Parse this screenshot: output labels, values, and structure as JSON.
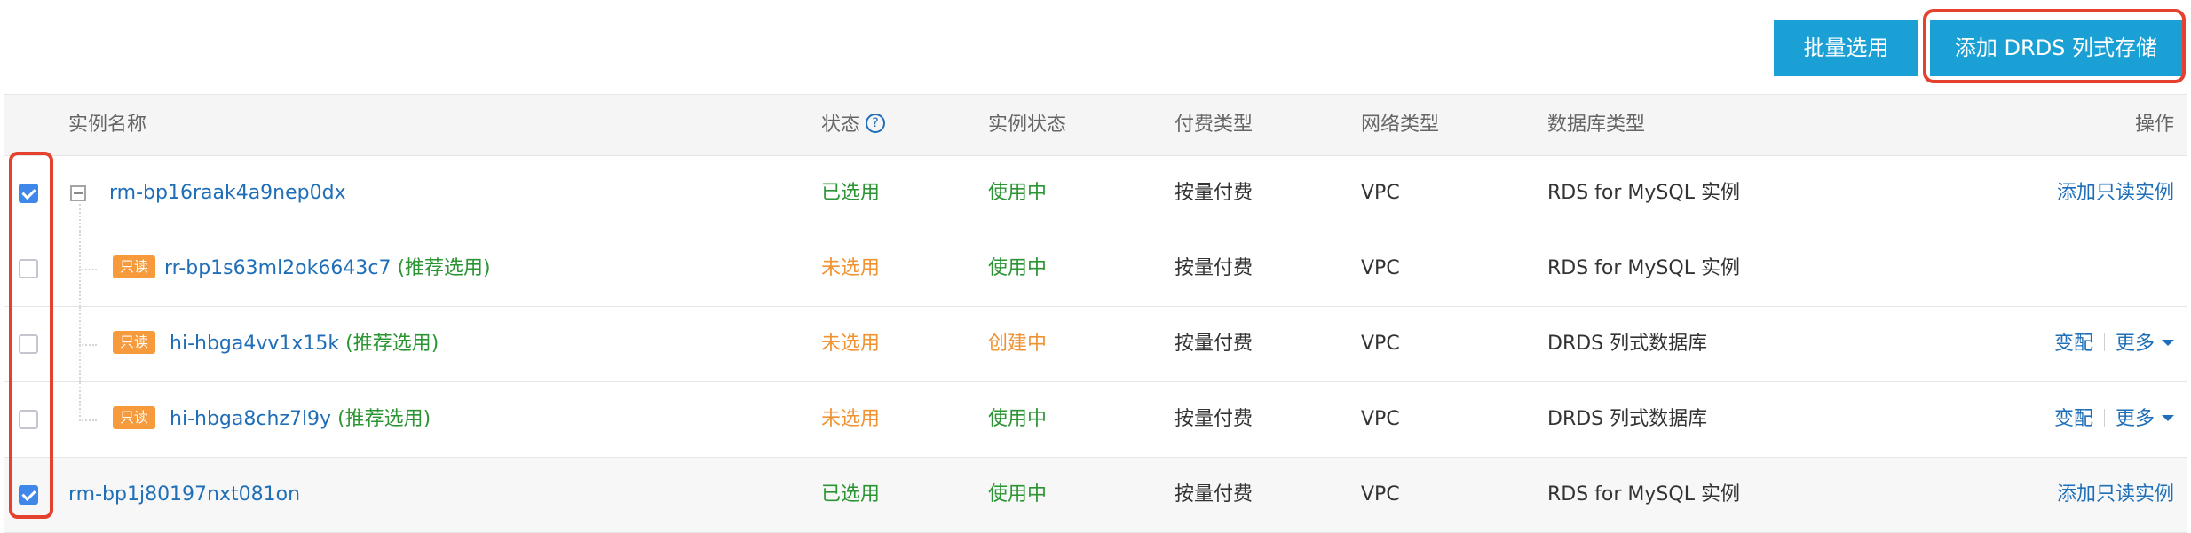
{
  "toolbar": {
    "batch_select_label": "批量选用",
    "add_drds_label": "添加 DRDS 列式存储"
  },
  "colors": {
    "primary_button": "#1aa0d4",
    "highlight_red": "#e4412f",
    "link_blue": "#1f6fb8",
    "status_green": "#2b9433",
    "status_orange": "#f09332",
    "readonly_tag": "#f69a3b",
    "checkbox_checked": "#3f87e8"
  },
  "table": {
    "headers": {
      "name": "实例名称",
      "state": "状态",
      "state_help_icon": "question-circle-icon",
      "state_help_glyph": "?",
      "instance_status": "实例状态",
      "pay_type": "付费类型",
      "network_type": "网络类型",
      "db_type": "数据库类型",
      "operations": "操作"
    },
    "rows": [
      {
        "checked": true,
        "expand_icon": "collapse-minus-icon",
        "name": "rm-bp16raak4a9nep0dx",
        "state": "已选用",
        "instance_status": "使用中",
        "pay_type": "按量付费",
        "network_type": "VPC",
        "db_type": "RDS for MySQL 实例",
        "op_primary": "添加只读实例"
      },
      {
        "checked": false,
        "tag": "只读",
        "name": "rr-bp1s63ml2ok6643c7",
        "recommend": "(推荐选用)",
        "state": "未选用",
        "instance_status": "使用中",
        "pay_type": "按量付费",
        "network_type": "VPC",
        "db_type": "RDS for MySQL 实例"
      },
      {
        "checked": false,
        "tag": "只读",
        "name": "hi-hbga4vv1x15k",
        "recommend": "(推荐选用)",
        "state": "未选用",
        "instance_status": "创建中",
        "pay_type": "按量付费",
        "network_type": "VPC",
        "db_type": "DRDS 列式数据库",
        "op_change": "变配",
        "op_more": "更多",
        "op_more_icon": "caret-down-icon"
      },
      {
        "checked": false,
        "tag": "只读",
        "name": "hi-hbga8chz7l9y",
        "recommend": "(推荐选用)",
        "state": "未选用",
        "instance_status": "使用中",
        "pay_type": "按量付费",
        "network_type": "VPC",
        "db_type": "DRDS 列式数据库",
        "op_change": "变配",
        "op_more": "更多",
        "op_more_icon": "caret-down-icon"
      },
      {
        "checked": true,
        "name": "rm-bp1j80197nxt081on",
        "state": "已选用",
        "instance_status": "使用中",
        "pay_type": "按量付费",
        "network_type": "VPC",
        "db_type": "RDS for MySQL 实例",
        "op_primary": "添加只读实例"
      }
    ]
  }
}
